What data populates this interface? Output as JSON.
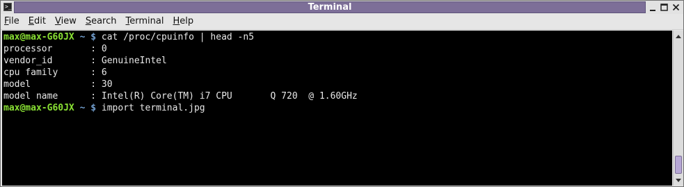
{
  "window": {
    "title": "Terminal",
    "app_icon_glyph": ">_"
  },
  "controls": {
    "minimize": "_",
    "maximize": "□",
    "close": "✕"
  },
  "menu": {
    "items": [
      {
        "underline": "F",
        "rest": "ile"
      },
      {
        "underline": "E",
        "rest": "dit"
      },
      {
        "underline": "V",
        "rest": "iew"
      },
      {
        "underline": "S",
        "rest": "earch"
      },
      {
        "underline": "T",
        "rest": "erminal"
      },
      {
        "underline": "H",
        "rest": "elp"
      }
    ]
  },
  "terminal": {
    "prompt_user": "max@max-G60JX",
    "prompt_path": " ~ $",
    "lines": [
      {
        "type": "prompt",
        "command": " cat /proc/cpuinfo | head -n5"
      },
      {
        "type": "output",
        "text": "processor       : 0"
      },
      {
        "type": "output",
        "text": "vendor_id       : GenuineIntel"
      },
      {
        "type": "output",
        "text": "cpu family      : 6"
      },
      {
        "type": "output",
        "text": "model           : 30"
      },
      {
        "type": "output",
        "text": "model name      : Intel(R) Core(TM) i7 CPU       Q 720  @ 1.60GHz"
      },
      {
        "type": "prompt",
        "command": " import terminal.jpg"
      }
    ],
    "colors": {
      "background": "#000000",
      "text": "#e8e8e8",
      "prompt_user": "#8ae234",
      "prompt_path": "#729fcf"
    }
  },
  "scrollbar": {
    "up_icon": "up-arrow-icon",
    "down_icon": "down-arrow-icon"
  }
}
